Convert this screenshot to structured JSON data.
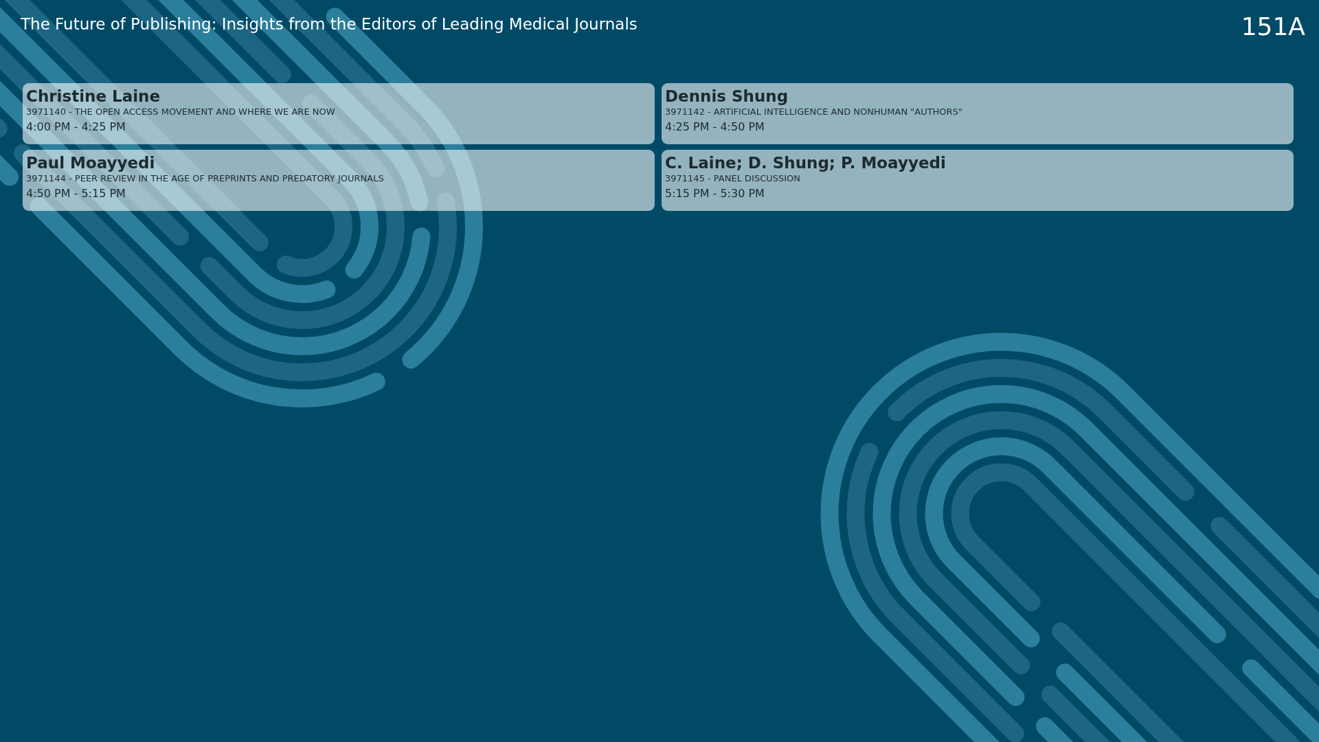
{
  "header": {
    "title": "The Future of Publishing: Insights from the Editors of Leading Medical Journals",
    "room": "151A"
  },
  "sessions": [
    {
      "presenter": "Christine Laine",
      "talk": "3971140 - THE OPEN ACCESS MOVEMENT AND WHERE WE ARE NOW",
      "time": "4:00 PM - 4:25 PM"
    },
    {
      "presenter": "Dennis Shung",
      "talk": "3971142 - ARTIFICIAL INTELLIGENCE AND NONHUMAN \"AUTHORS\"",
      "time": "4:25 PM - 4:50 PM"
    },
    {
      "presenter": "Paul Moayyedi",
      "talk": "3971144 - PEER REVIEW IN THE AGE OF PREPRINTS AND PREDATORY JOURNALS",
      "time": "4:50 PM - 5:15 PM"
    },
    {
      "presenter": "C. Laine; D. Shung; P. Moayyedi",
      "talk": "3971145 - PANEL DISCUSSION",
      "time": "5:15 PM - 5:30 PM"
    }
  ]
}
